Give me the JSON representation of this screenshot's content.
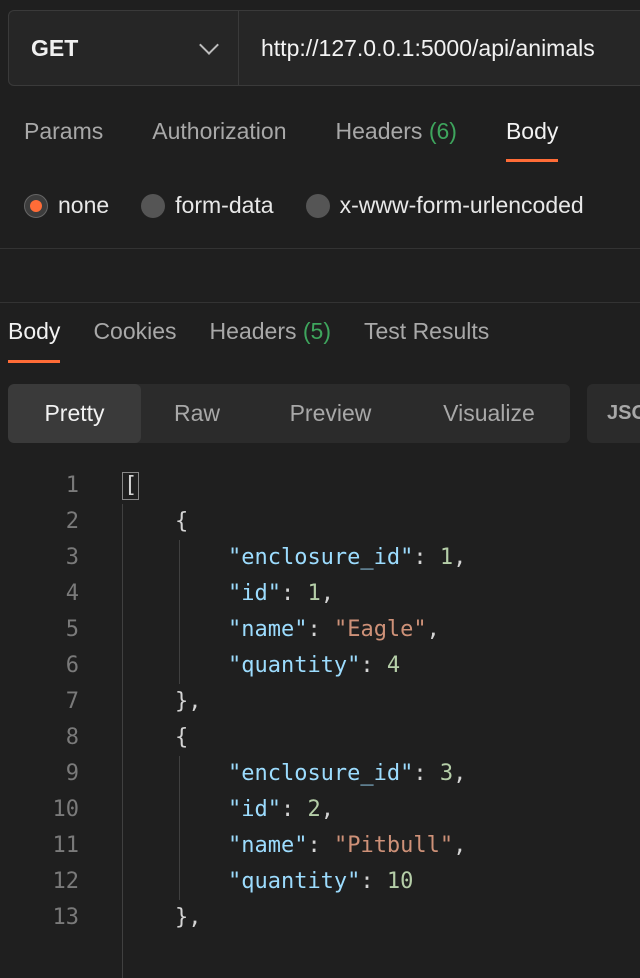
{
  "request": {
    "method": "GET",
    "url": "http://127.0.0.1:5000/api/animals"
  },
  "request_tabs": [
    {
      "label": "Params"
    },
    {
      "label": "Authorization"
    },
    {
      "label": "Headers",
      "count": "(6)"
    },
    {
      "label": "Body",
      "active": true
    }
  ],
  "body_types": [
    {
      "label": "none",
      "selected": true
    },
    {
      "label": "form-data"
    },
    {
      "label": "x-www-form-urlencoded"
    }
  ],
  "response_tabs": [
    {
      "label": "Body",
      "active": true
    },
    {
      "label": "Cookies"
    },
    {
      "label": "Headers",
      "count": "(5)"
    },
    {
      "label": "Test Results"
    }
  ],
  "view_options": [
    {
      "label": "Pretty",
      "active": true
    },
    {
      "label": "Raw"
    },
    {
      "label": "Preview"
    },
    {
      "label": "Visualize"
    }
  ],
  "format": "JSON",
  "code_lines": [
    {
      "n": "1",
      "tokens": [
        {
          "t": "[",
          "c": "p"
        }
      ]
    },
    {
      "n": "2",
      "tokens": [
        {
          "t": "    {",
          "c": "p"
        }
      ]
    },
    {
      "n": "3",
      "tokens": [
        {
          "t": "        ",
          "c": "p"
        },
        {
          "t": "\"enclosure_id\"",
          "c": "k"
        },
        {
          "t": ": ",
          "c": "p"
        },
        {
          "t": "1",
          "c": "n"
        },
        {
          "t": ",",
          "c": "p"
        }
      ]
    },
    {
      "n": "4",
      "tokens": [
        {
          "t": "        ",
          "c": "p"
        },
        {
          "t": "\"id\"",
          "c": "k"
        },
        {
          "t": ": ",
          "c": "p"
        },
        {
          "t": "1",
          "c": "n"
        },
        {
          "t": ",",
          "c": "p"
        }
      ]
    },
    {
      "n": "5",
      "tokens": [
        {
          "t": "        ",
          "c": "p"
        },
        {
          "t": "\"name\"",
          "c": "k"
        },
        {
          "t": ": ",
          "c": "p"
        },
        {
          "t": "\"Eagle\"",
          "c": "s"
        },
        {
          "t": ",",
          "c": "p"
        }
      ]
    },
    {
      "n": "6",
      "tokens": [
        {
          "t": "        ",
          "c": "p"
        },
        {
          "t": "\"quantity\"",
          "c": "k"
        },
        {
          "t": ": ",
          "c": "p"
        },
        {
          "t": "4",
          "c": "n"
        }
      ]
    },
    {
      "n": "7",
      "tokens": [
        {
          "t": "    },",
          "c": "p"
        }
      ]
    },
    {
      "n": "8",
      "tokens": [
        {
          "t": "    {",
          "c": "p"
        }
      ]
    },
    {
      "n": "9",
      "tokens": [
        {
          "t": "        ",
          "c": "p"
        },
        {
          "t": "\"enclosure_id\"",
          "c": "k"
        },
        {
          "t": ": ",
          "c": "p"
        },
        {
          "t": "3",
          "c": "n"
        },
        {
          "t": ",",
          "c": "p"
        }
      ]
    },
    {
      "n": "10",
      "tokens": [
        {
          "t": "        ",
          "c": "p"
        },
        {
          "t": "\"id\"",
          "c": "k"
        },
        {
          "t": ": ",
          "c": "p"
        },
        {
          "t": "2",
          "c": "n"
        },
        {
          "t": ",",
          "c": "p"
        }
      ]
    },
    {
      "n": "11",
      "tokens": [
        {
          "t": "        ",
          "c": "p"
        },
        {
          "t": "\"name\"",
          "c": "k"
        },
        {
          "t": ": ",
          "c": "p"
        },
        {
          "t": "\"Pitbull\"",
          "c": "s"
        },
        {
          "t": ",",
          "c": "p"
        }
      ]
    },
    {
      "n": "12",
      "tokens": [
        {
          "t": "        ",
          "c": "p"
        },
        {
          "t": "\"quantity\"",
          "c": "k"
        },
        {
          "t": ": ",
          "c": "p"
        },
        {
          "t": "10",
          "c": "n"
        }
      ]
    },
    {
      "n": "13",
      "tokens": [
        {
          "t": "    },",
          "c": "p"
        }
      ]
    }
  ],
  "colors": {
    "accent": "#ff6c37",
    "count": "#3ea55d",
    "key": "#9cdcfe",
    "string": "#ce9178",
    "number": "#b5cea8"
  }
}
